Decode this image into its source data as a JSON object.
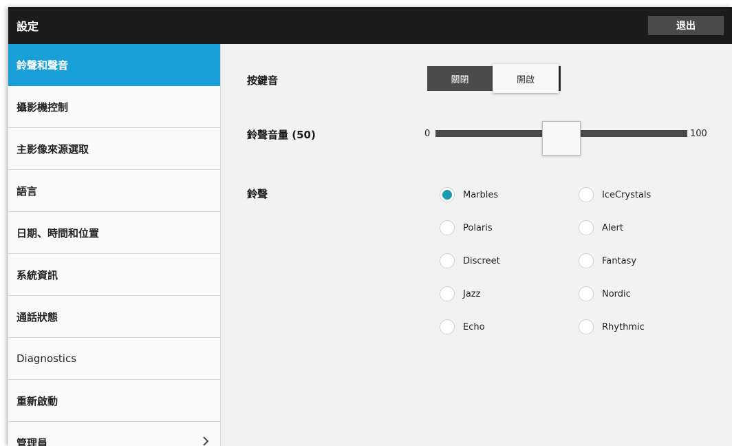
{
  "header": {
    "title": "設定",
    "exit_label": "退出"
  },
  "sidebar": {
    "items": [
      {
        "label": "鈴聲和聲音",
        "active": true
      },
      {
        "label": "攝影機控制"
      },
      {
        "label": "主影像來源選取"
      },
      {
        "label": "語言"
      },
      {
        "label": "日期、時間和位置"
      },
      {
        "label": "系統資訊"
      },
      {
        "label": "通話狀態"
      },
      {
        "label": "Diagnostics"
      },
      {
        "label": "重新啟動"
      },
      {
        "label": "管理員",
        "has_chevron": true
      }
    ],
    "chevron_icon": "chevron-right-icon"
  },
  "keytone": {
    "label": "按鍵音",
    "off_label": "關閉",
    "on_label": "開啟",
    "selected": "on"
  },
  "volume": {
    "label": "鈴聲音量 (50)",
    "min_label": "0",
    "max_label": "100",
    "value": 50,
    "min": 0,
    "max": 100
  },
  "ringtone": {
    "label": "鈴聲",
    "selected": "Marbles",
    "options": [
      "Marbles",
      "IceCrystals",
      "Polaris",
      "Alert",
      "Discreet",
      "Fantasy",
      "Jazz",
      "Nordic",
      "Echo",
      "Rhythmic"
    ]
  },
  "colors": {
    "accent": "#1aa0d9",
    "radio_selected": "#1a9bb0",
    "titlebar": "#1c1c1c"
  }
}
